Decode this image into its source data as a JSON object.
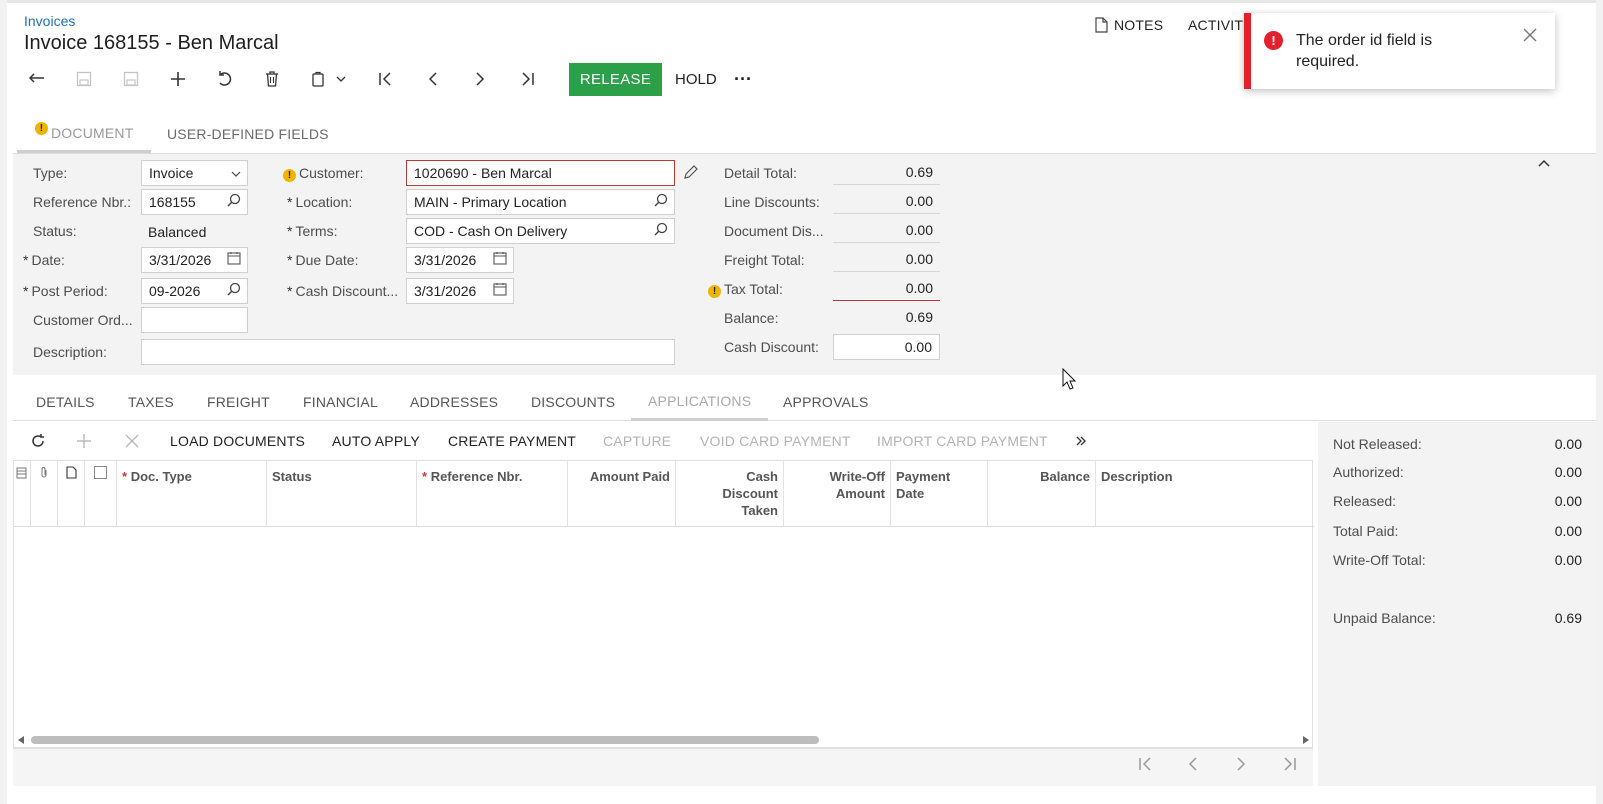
{
  "breadcrumb": "Invoices",
  "title": "Invoice 168155 - Ben Marcal",
  "header_links": {
    "notes": "NOTES",
    "activities": "ACTIVITI"
  },
  "toolbar": {
    "release": "RELEASE",
    "hold": "HOLD",
    "more": "···",
    "icons": [
      "undo-arrow-icon",
      "save-close-icon",
      "save-icon",
      "add-icon",
      "cancel-icon",
      "delete-icon",
      "copy-paste-icon",
      "first-icon",
      "prev-icon",
      "next-icon",
      "last-icon"
    ]
  },
  "tabs": [
    "DOCUMENT",
    "USER-DEFINED FIELDS"
  ],
  "form": {
    "type_label": "Type:",
    "type_value": "Invoice",
    "refnbr_label": "Reference Nbr.:",
    "refnbr_value": "168155",
    "status_label": "Status:",
    "status_value": "Balanced",
    "date_label": "Date:",
    "date_value": "3/31/2026",
    "postperiod_label": "Post Period:",
    "postperiod_value": "09-2026",
    "custord_label": "Customer Ord...",
    "custord_value": "",
    "desc_label": "Description:",
    "desc_value": "",
    "customer_label": "Customer:",
    "customer_value": "1020690 - Ben Marcal",
    "location_label": "Location:",
    "location_value": "MAIN - Primary Location",
    "terms_label": "Terms:",
    "terms_value": "COD - Cash On Delivery",
    "duedate_label": "Due Date:",
    "duedate_value": "3/31/2026",
    "cashdisc_label": "Cash Discount...",
    "cashdisc_value": "3/31/2026"
  },
  "totals": {
    "detail_total_label": "Detail Total:",
    "detail_total": "0.69",
    "line_disc_label": "Line Discounts:",
    "line_disc": "0.00",
    "doc_disc_label": "Document Dis...",
    "doc_disc": "0.00",
    "freight_label": "Freight Total:",
    "freight": "0.00",
    "tax_label": "Tax Total:",
    "tax": "0.00",
    "balance_label": "Balance:",
    "balance": "0.69",
    "cash_disc_label": "Cash Discount:",
    "cash_disc": "0.00"
  },
  "subtabs": [
    "DETAILS",
    "TAXES",
    "FREIGHT",
    "FINANCIAL",
    "ADDRESSES",
    "DISCOUNTS",
    "APPLICATIONS",
    "APPROVALS"
  ],
  "grid_toolbar": {
    "load_documents": "LOAD DOCUMENTS",
    "auto_apply": "AUTO APPLY",
    "create_payment": "CREATE PAYMENT",
    "capture": "CAPTURE",
    "void_card_payment": "VOID CARD PAYMENT",
    "import_card_payment": "IMPORT CARD PAYMENT"
  },
  "grid_columns": {
    "doc_type": "Doc. Type",
    "status": "Status",
    "reference_nbr": "Reference Nbr.",
    "amount_paid": "Amount Paid",
    "cash_discount_taken": "Cash Discount Taken",
    "write_off_amount": "Write-Off Amount",
    "payment_date": "Payment Date",
    "balance": "Balance",
    "description": "Description"
  },
  "summary": {
    "not_released_label": "Not Released:",
    "not_released": "0.00",
    "authorized_label": "Authorized:",
    "authorized": "0.00",
    "released_label": "Released:",
    "released": "0.00",
    "total_paid_label": "Total Paid:",
    "total_paid": "0.00",
    "write_off_label": "Write-Off Total:",
    "write_off": "0.00",
    "unpaid_label": "Unpaid Balance:",
    "unpaid": "0.69"
  },
  "toast": {
    "message": "The order id field is required."
  },
  "colors": {
    "release_green": "#2c9f49",
    "error_red": "#e3202c",
    "link_blue": "#1f6fb5",
    "warning_yellow": "#f0b400"
  }
}
